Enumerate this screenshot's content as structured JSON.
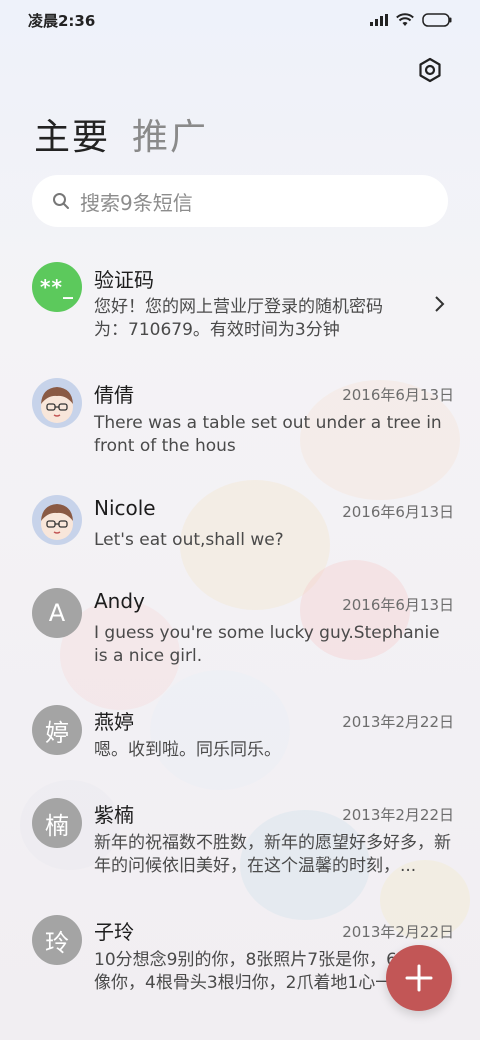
{
  "status_bar": {
    "time": "凌晨2:36"
  },
  "tabs": [
    {
      "label": "主要",
      "active": true
    },
    {
      "label": "推广",
      "active": false
    }
  ],
  "search": {
    "placeholder": "搜索9条短信"
  },
  "conversations": [
    {
      "name": "验证码",
      "date": "",
      "preview": "您好！您的网上营业厅登录的随机密码为：710679。有效时间为3分钟",
      "avatar": {
        "type": "code",
        "text": "**_"
      }
    },
    {
      "name": "倩倩",
      "date": "2016年6月13日",
      "preview": "There was a table set out under a tree in front of the hous",
      "avatar": {
        "type": "cartoon"
      }
    },
    {
      "name": "Nicole",
      "date": "2016年6月13日",
      "preview": "Let's eat out,shall we?",
      "avatar": {
        "type": "cartoon"
      }
    },
    {
      "name": "Andy",
      "date": "2016年6月13日",
      "preview": "I guess you're some lucky guy.Stephanie is a nice girl.",
      "avatar": {
        "type": "letter",
        "text": "A"
      }
    },
    {
      "name": "燕婷",
      "date": "2013年2月22日",
      "preview": "嗯。收到啦。同乐同乐。",
      "avatar": {
        "type": "letter",
        "text": "婷"
      }
    },
    {
      "name": "紫楠",
      "date": "2013年2月22日",
      "preview": "新年的祝福数不胜数，新年的愿望好多好多，新年的问候依旧美好，在这个温馨的时刻，...",
      "avatar": {
        "type": "letter",
        "text": "楠"
      }
    },
    {
      "name": "子玲",
      "date": "2013年2月22日",
      "preview": "10分想念9别的你，8张照片7张是你，6月5只像你，4根骨头3根归你，2爪着地1心一意",
      "avatar": {
        "type": "letter",
        "text": "玲"
      }
    }
  ],
  "colors": {
    "accent_fab": "#c25656",
    "code_avatar": "#5cc95c",
    "letter_avatar": "#a4a4a4"
  },
  "icons": [
    "signal-icon",
    "wifi-icon",
    "battery-icon",
    "settings-icon",
    "search-icon",
    "chevron-right-icon",
    "plus-icon"
  ]
}
